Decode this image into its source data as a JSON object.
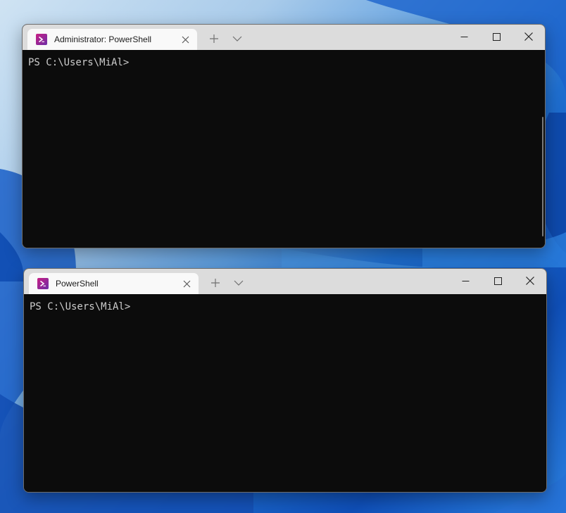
{
  "windows": [
    {
      "tab_title": "Administrator: PowerShell",
      "prompt": "PS C:\\Users\\MiAl>",
      "icons": {
        "app": "powershell-icon",
        "tab_close": "close-icon",
        "new_tab": "plus-icon",
        "dropdown": "chevron-down-icon",
        "minimize": "minimize-icon",
        "maximize": "maximize-icon",
        "close": "close-icon"
      }
    },
    {
      "tab_title": "PowerShell",
      "prompt": "PS C:\\Users\\MiAl>",
      "icons": {
        "app": "powershell-icon",
        "tab_close": "close-icon",
        "new_tab": "plus-icon",
        "dropdown": "chevron-down-icon",
        "minimize": "minimize-icon",
        "maximize": "maximize-icon",
        "close": "close-icon"
      }
    }
  ],
  "colors": {
    "console_background": "#0c0c0c",
    "console_text": "#cccccc",
    "titlebar": "#dcdcdc",
    "active_tab": "#f9f9f9",
    "powershell_icon": "#c81e83"
  }
}
